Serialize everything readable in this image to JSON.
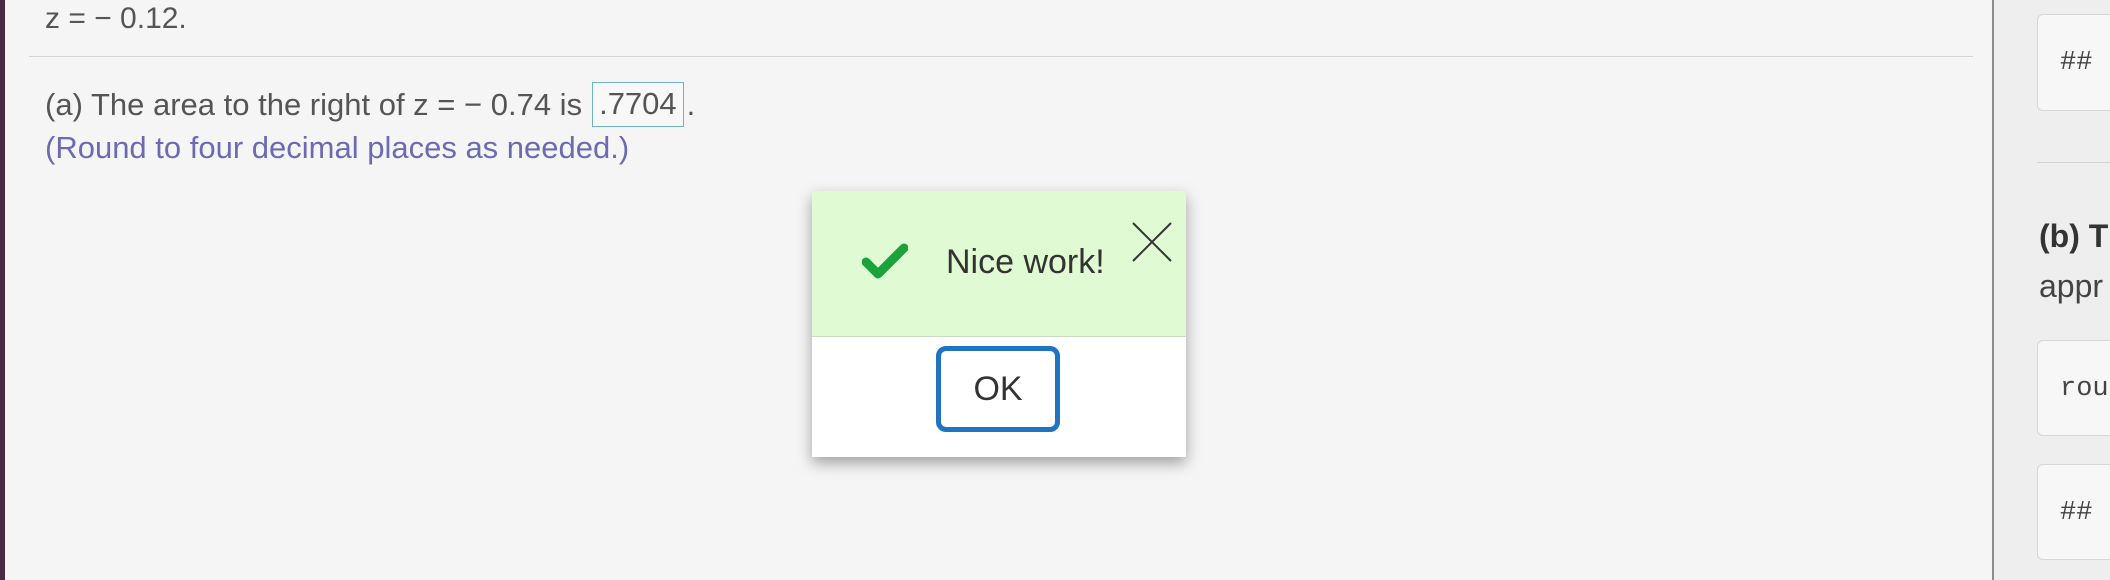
{
  "main": {
    "previous_line": "z = − 0.12.",
    "question": {
      "prefix": "(a) The area to the right of z = − 0.74 is",
      "answer": ".7704",
      "suffix": "."
    },
    "hint": "(Round to four decimal places as needed.)"
  },
  "dialog": {
    "message": "Nice work!",
    "ok_label": "OK",
    "success_color": "#1aa33a",
    "banner_color": "#e0fad3"
  },
  "side_panel": {
    "code_box_1": "##",
    "part_b_title": "(b) T",
    "part_b_text": "appr",
    "code_box_2": "rou",
    "code_box_3": "##"
  }
}
